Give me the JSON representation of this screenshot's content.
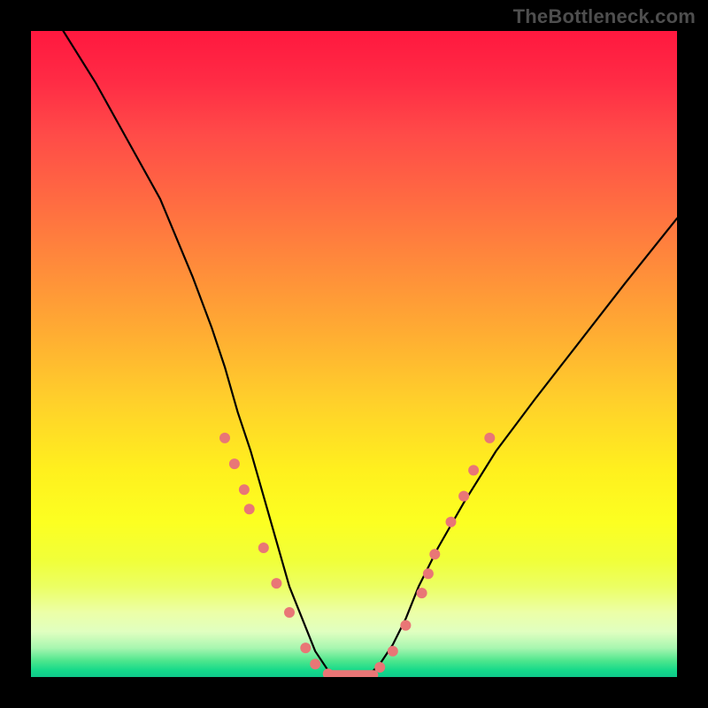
{
  "attribution": "TheBottleneck.com",
  "chart_data": {
    "type": "line",
    "title": "",
    "xlabel": "",
    "ylabel": "",
    "xlim": [
      0,
      100
    ],
    "ylim": [
      0,
      100
    ],
    "grid": false,
    "curve": {
      "description": "Approximate V-shaped bottleneck curve; y = distance from optimal match",
      "x": [
        5,
        10,
        15,
        20,
        25,
        28,
        30,
        32,
        34,
        36,
        38,
        40,
        42,
        44,
        46,
        48,
        50,
        52,
        54,
        56,
        58,
        60,
        63,
        67,
        72,
        78,
        85,
        92,
        100
      ],
      "y": [
        100,
        92,
        83,
        74,
        62,
        54,
        48,
        41,
        35,
        28,
        21,
        14,
        9,
        4,
        1,
        0,
        0,
        0,
        2,
        5,
        9,
        14,
        20,
        27,
        35,
        43,
        52,
        61,
        71
      ]
    },
    "flat_range_x": [
      46,
      53
    ],
    "scatter": {
      "description": "pink markers overlaid near bottom of V",
      "color": "#e97676",
      "points": [
        {
          "x": 30,
          "y": 37
        },
        {
          "x": 31.5,
          "y": 33
        },
        {
          "x": 33,
          "y": 29
        },
        {
          "x": 33.8,
          "y": 26
        },
        {
          "x": 36,
          "y": 20
        },
        {
          "x": 38,
          "y": 14.5
        },
        {
          "x": 40,
          "y": 10
        },
        {
          "x": 42.5,
          "y": 4.5
        },
        {
          "x": 44,
          "y": 2
        },
        {
          "x": 46,
          "y": 0.5
        },
        {
          "x": 48,
          "y": 0
        },
        {
          "x": 50,
          "y": 0
        },
        {
          "x": 52,
          "y": 0.2
        },
        {
          "x": 54,
          "y": 1.5
        },
        {
          "x": 56,
          "y": 4
        },
        {
          "x": 58,
          "y": 8
        },
        {
          "x": 60.5,
          "y": 13
        },
        {
          "x": 61.5,
          "y": 16
        },
        {
          "x": 62.5,
          "y": 19
        },
        {
          "x": 65,
          "y": 24
        },
        {
          "x": 67,
          "y": 28
        },
        {
          "x": 68.5,
          "y": 32
        },
        {
          "x": 71,
          "y": 37
        }
      ]
    },
    "gradient_stops": [
      {
        "pos": 0,
        "color": "#ff183f"
      },
      {
        "pos": 50,
        "color": "#ffcf2b"
      },
      {
        "pos": 80,
        "color": "#fcff21"
      },
      {
        "pos": 97,
        "color": "#4de68d"
      },
      {
        "pos": 100,
        "color": "#0fc98a"
      }
    ]
  }
}
